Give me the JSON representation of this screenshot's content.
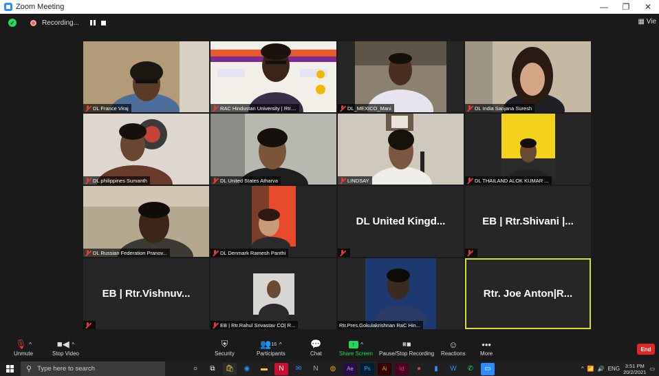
{
  "window": {
    "title": "Zoom Meeting",
    "minimize": "—",
    "maximize": "❐",
    "close": "✕"
  },
  "recording": {
    "label": "Recording..."
  },
  "view_label": "▦ Vie",
  "participants": [
    {
      "name": "DL France Viraj",
      "video": true,
      "bg": "#a9946f"
    },
    {
      "name": "RAC Hindustan University | Rtr....",
      "video": true,
      "bg": "#e9e4dc"
    },
    {
      "name": "DL_MEXICO_Mani",
      "video": true,
      "bg": "#7d7460"
    },
    {
      "name": "DL India Sanjana Suresh",
      "video": true,
      "bg": "#b9a98f"
    },
    {
      "name": "DL philippines Sumanth",
      "video": true,
      "bg": "#8e7a63"
    },
    {
      "name": "DL United States Atharva",
      "video": true,
      "bg": "#9a9a90"
    },
    {
      "name": "LINDSAY",
      "video": true,
      "bg": "#b7ada2"
    },
    {
      "name": "DL THAILAND ALOK KUMAR ...",
      "video": true,
      "bg": "#4a3e22"
    },
    {
      "name": "DL Russian Federation Pranov...",
      "video": true,
      "bg": "#6b5b45"
    },
    {
      "name": "DL Denmark Ramesh Panthi",
      "video": true,
      "bg": "#262626"
    },
    {
      "name": "",
      "video": false,
      "display": "DL United Kingd..."
    },
    {
      "name": "",
      "video": false,
      "display": "EB | Rtr.Shivani |..."
    },
    {
      "name": "",
      "video": false,
      "display": "EB | Rtr.Vishnuv..."
    },
    {
      "name": "EB | Rtr.Rahul Srivastav CO| R...",
      "video": true,
      "bg": "#262626"
    },
    {
      "name": "Rtr.Pres.Gokulakrishnan RaC Hin...",
      "video": true,
      "bg": "#1b2a45"
    },
    {
      "name": "",
      "video": false,
      "display": "Rtr. Joe Anton|R...",
      "active": true
    }
  ],
  "toolbar": {
    "unmute": "Unmute",
    "stop_video": "Stop Video",
    "security": "Security",
    "participants": "Participants",
    "participants_count": "16",
    "chat": "Chat",
    "share_screen": "Share Screen",
    "pause_recording": "Pause/Stop Recording",
    "reactions": "Reactions",
    "more": "More",
    "end": "End"
  },
  "taskbar": {
    "search_placeholder": "Type here to search",
    "lang": "ENG",
    "time": "3:51 PM",
    "date": "20/2/2021"
  }
}
